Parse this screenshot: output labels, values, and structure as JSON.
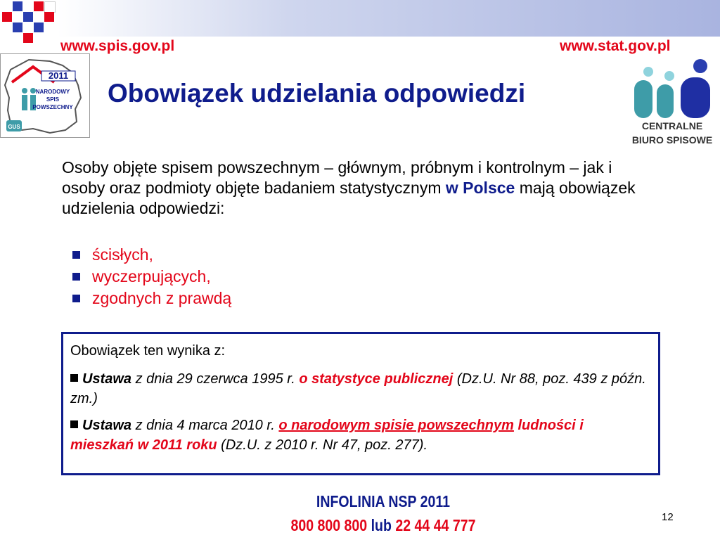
{
  "header": {
    "left_link": "www.spis.gov.pl",
    "right_link": "www.stat.gov.pl"
  },
  "logo_left": {
    "year": "2011",
    "line1": "NARODOWY",
    "line2": "SPIS",
    "line3": "POWSZECHNY",
    "badge": "GUS"
  },
  "logo_right": {
    "line1": "CENTRALNE",
    "line2": "BIURO SPISOWE"
  },
  "slide": {
    "title": "Obowiązek udzielania odpowiedzi",
    "intro_part1": "Osoby objęte spisem powszechnym – głównym, próbnym i kontrolnym – jak i osoby oraz podmioty objęte badaniem statystycznym ",
    "intro_highlight": "w Polsce",
    "intro_part2": " mają obowiązek udzielenia odpowiedzi:",
    "bullets": [
      "ścisłych,",
      "wyczerpujących,",
      "zgodnych z prawdą"
    ]
  },
  "box": {
    "lead": "Obowiązek ten wynika z:",
    "law1": {
      "prefix": "Ustawa",
      "date": " z dnia 29 czerwca 1995 r. ",
      "name": "o statystyce publicznej",
      "ref": " (Dz.U. Nr 88, poz. 439 z późn. zm.)"
    },
    "law2": {
      "prefix": "Ustawa",
      "date": " z dnia 4 marca 2010 r. ",
      "name_underlined": "o narodowym spisie powszechnym",
      "name_rest": " ludności i mieszkań w    2011 roku",
      "ref": " (Dz.U. z 2010 r. Nr 47, poz. 277)."
    }
  },
  "footer": {
    "infoline": "INFOLINIA NSP 2011",
    "phone1": "800 800 800",
    "conj": " lub ",
    "phone2": "22 44 44 777",
    "page": "12"
  },
  "colors": {
    "navy": "#0f1c8c",
    "red": "#e3061a"
  },
  "icons": [
    "grid-squares-icon",
    "poland-map-icon",
    "people-icon"
  ]
}
